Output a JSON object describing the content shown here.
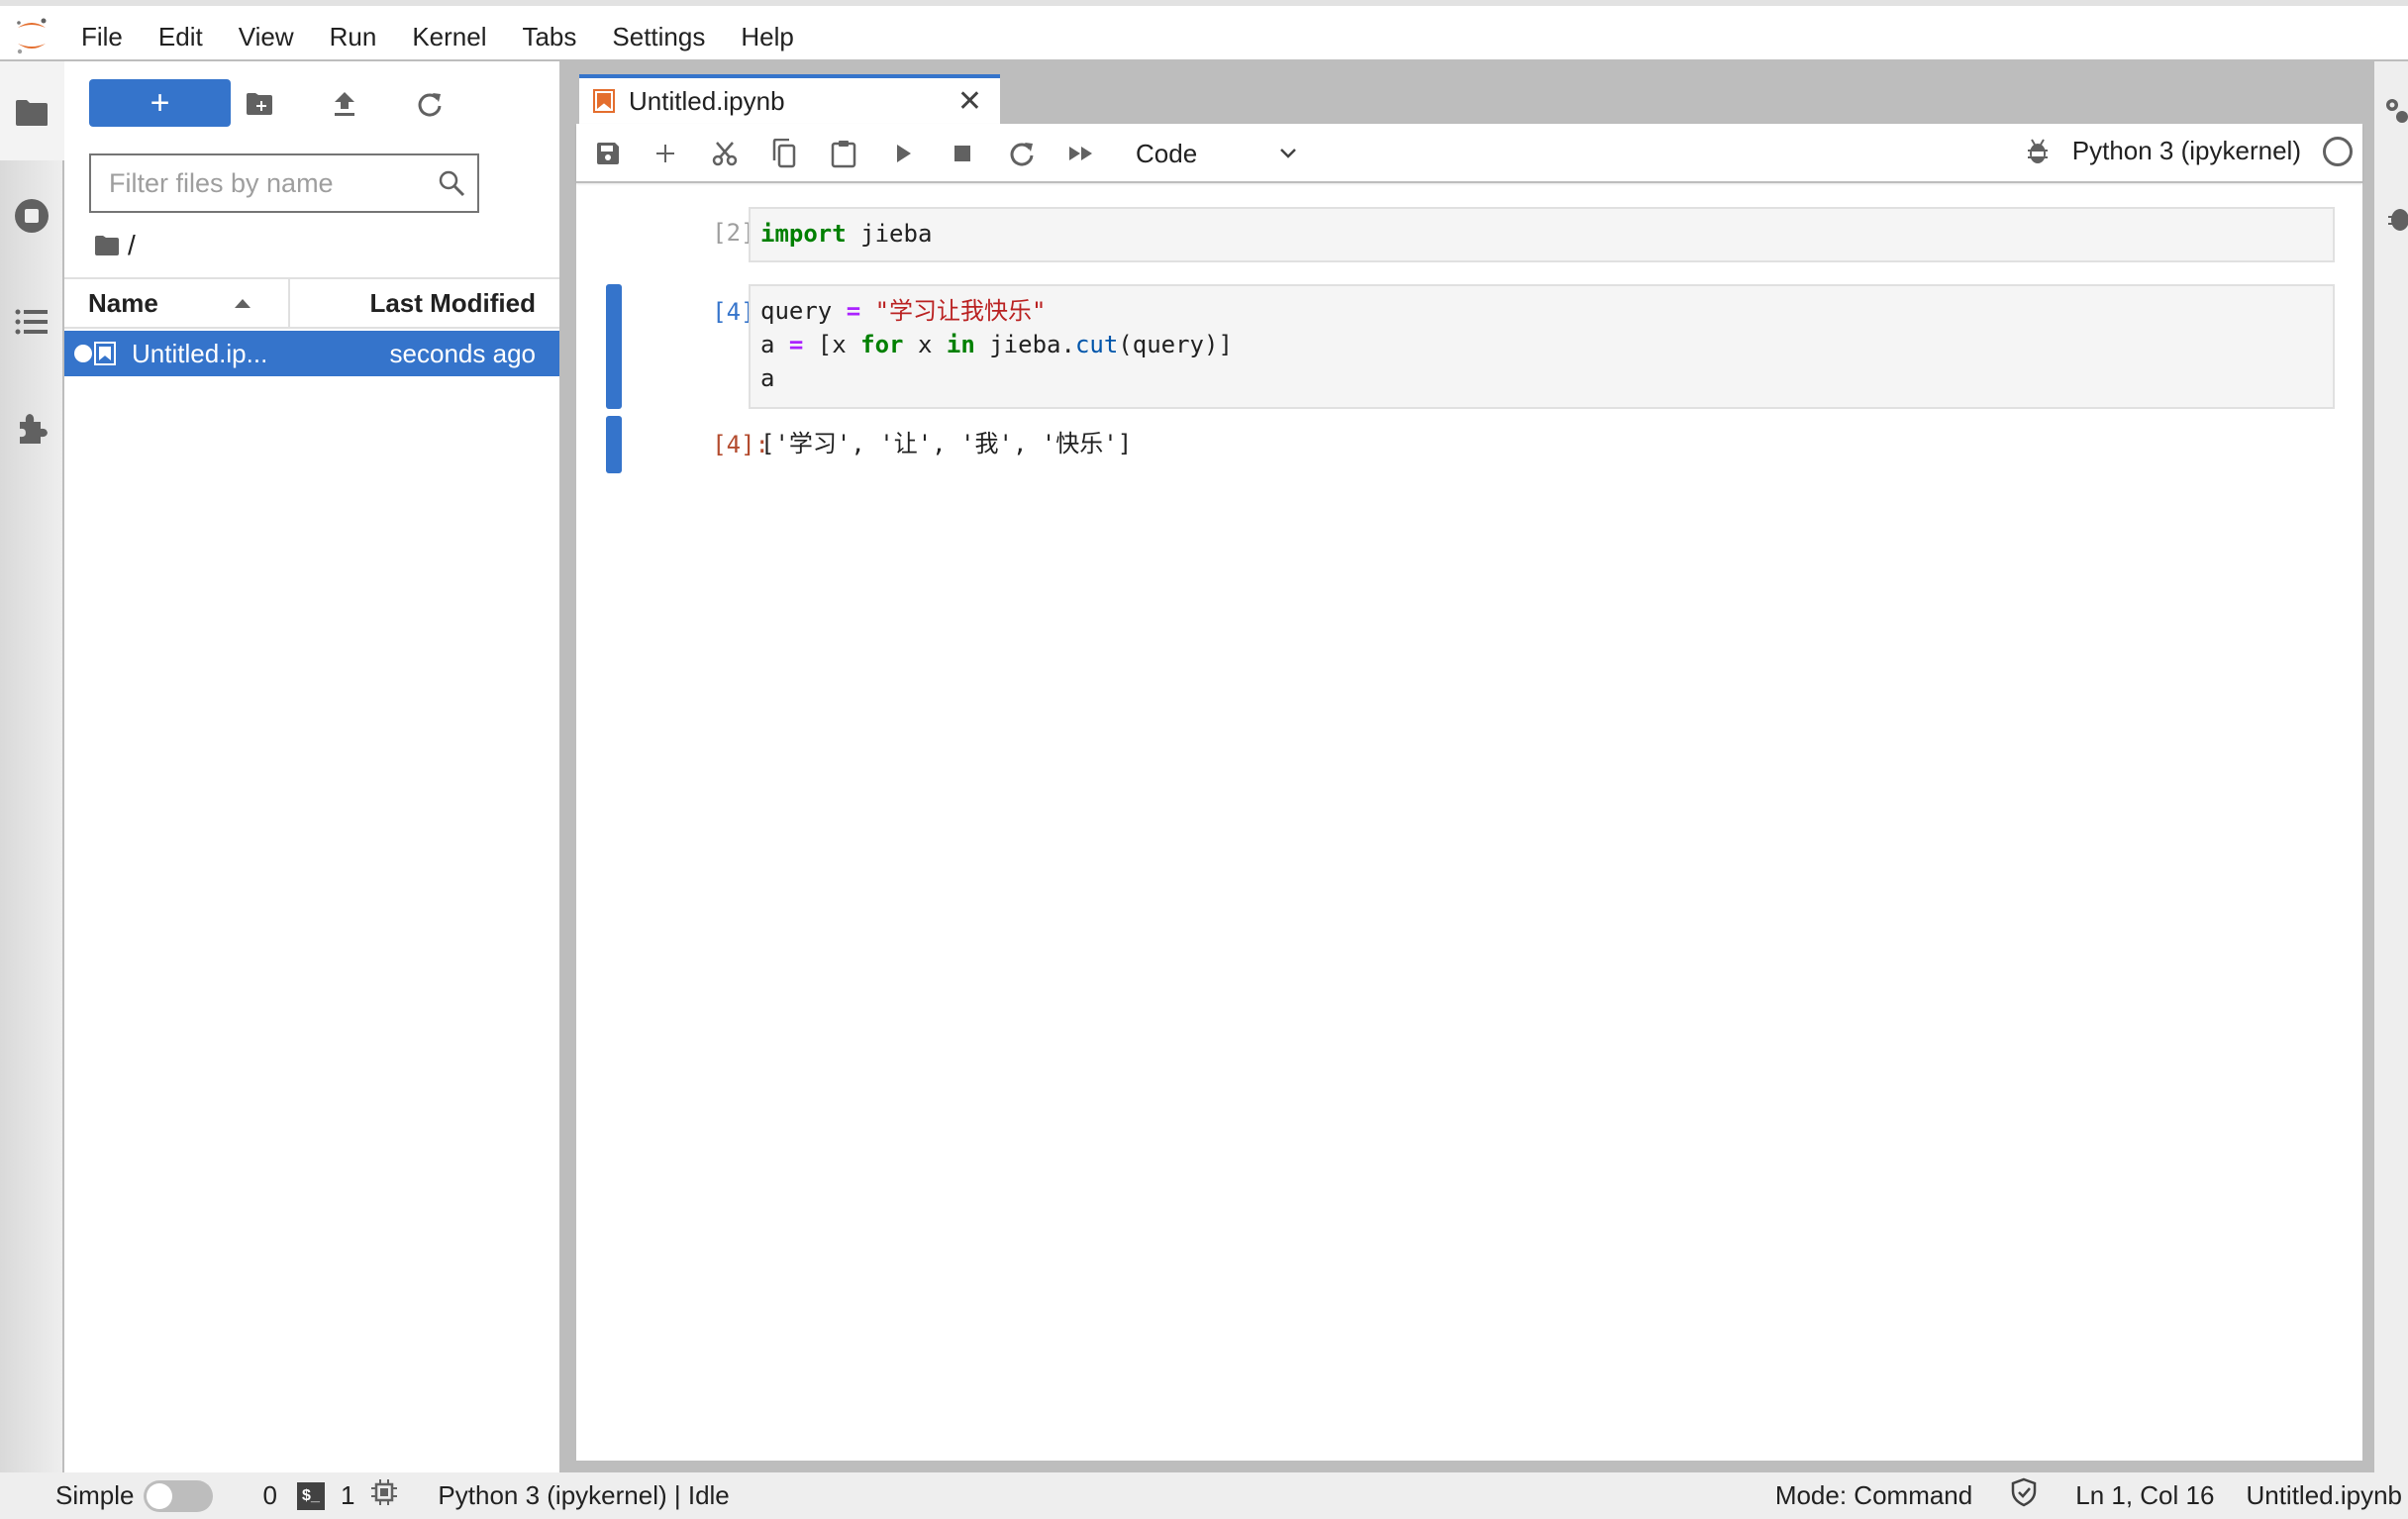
{
  "menubar": {
    "items": [
      "File",
      "Edit",
      "View",
      "Run",
      "Kernel",
      "Tabs",
      "Settings",
      "Help"
    ]
  },
  "left_strip": {
    "icons": [
      "folder-icon",
      "running-stop-icon",
      "table-of-contents-icon",
      "extension-puzzle-icon"
    ]
  },
  "file_browser": {
    "launcher_label": "+",
    "toolbar_icons": [
      "new-folder-icon",
      "upload-icon",
      "refresh-icon"
    ],
    "filter_placeholder": "Filter files by name",
    "filter_value": "",
    "breadcrumb": "/",
    "columns": {
      "name": "Name",
      "modified": "Last Modified"
    },
    "sort": {
      "column": "Name",
      "direction": "ascending"
    },
    "files": [
      {
        "name": "Untitled.ip...",
        "modified": "seconds ago",
        "selected": true,
        "running": true
      }
    ]
  },
  "tabs": [
    {
      "label": "Untitled.ipynb",
      "active": true
    }
  ],
  "notebook_toolbar": {
    "buttons": [
      "save",
      "insert-cell",
      "cut",
      "copy",
      "paste",
      "run",
      "interrupt",
      "restart",
      "restart-run-all"
    ],
    "cell_type": "Code",
    "kernel_name": "Python 3 (ipykernel)",
    "kernel_status": "idle"
  },
  "cells": [
    {
      "prompt": "[2]:",
      "lines": [
        [
          {
            "t": "import",
            "c": "kw"
          },
          {
            "t": " jieba",
            "c": ""
          }
        ]
      ]
    },
    {
      "prompt": "[4]:",
      "selected": true,
      "lines": [
        [
          {
            "t": "query ",
            "c": ""
          },
          {
            "t": "=",
            "c": "op"
          },
          {
            "t": " \"学习让我快乐\"",
            "c": "str"
          }
        ],
        [
          {
            "t": "a ",
            "c": ""
          },
          {
            "t": "=",
            "c": "op"
          },
          {
            "t": " [x ",
            "c": ""
          },
          {
            "t": "for",
            "c": "kw"
          },
          {
            "t": " x ",
            "c": ""
          },
          {
            "t": "in",
            "c": "kw"
          },
          {
            "t": " jieba.",
            "c": ""
          },
          {
            "t": "cut",
            "c": "fn"
          },
          {
            "t": "(query)]",
            "c": ""
          }
        ],
        [
          {
            "t": "a",
            "c": ""
          }
        ]
      ],
      "output_prompt": "[4]:",
      "output": "['学习', '让', '我', '快乐']"
    }
  ],
  "statusbar": {
    "simple_label": "Simple",
    "simple_enabled": false,
    "terminals": "0",
    "kernels": "1",
    "kernel_status": "Python 3 (ipykernel) | Idle",
    "mode": "Mode: Command",
    "cursor": "Ln 1, Col 16",
    "filename": "Untitled.ipynb"
  },
  "colors": {
    "accent": "#3574cb",
    "notebook_icon": "#e46e2e",
    "keyword": "#008000",
    "operator": "#aa22ff",
    "string": "#ba2121",
    "function": "#0055aa",
    "output_prompt": "#b34b2e"
  }
}
